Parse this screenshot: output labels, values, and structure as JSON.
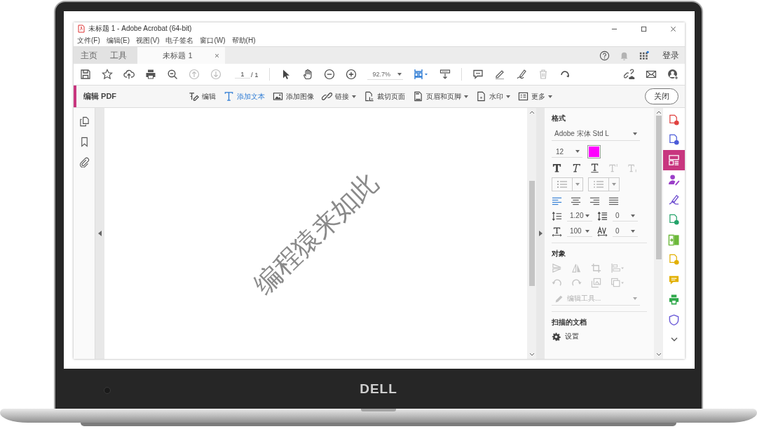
{
  "window": {
    "title": "未标题 1 - Adobe Acrobat (64-bit)"
  },
  "menu": [
    "文件(F)",
    "编辑(E)",
    "视图(V)",
    "电子签名",
    "窗口(W)",
    "帮助(H)"
  ],
  "nav_tabs": [
    {
      "label": "主页",
      "selected": false
    },
    {
      "label": "工具",
      "selected": false
    }
  ],
  "doc_tabs": [
    {
      "label": "未标题 1",
      "selected": true
    }
  ],
  "account": {
    "sign_in": "登录"
  },
  "toolbar": {
    "page": "1",
    "page_total": "/ 1",
    "zoom": "92.7%"
  },
  "edit_bar": {
    "title": "编辑 PDF",
    "close": "关闭",
    "tools": [
      {
        "kind": "edit",
        "label": "编辑",
        "selected": false,
        "dropdown": false
      },
      {
        "kind": "text",
        "label": "添加文本",
        "selected": true,
        "dropdown": false
      },
      {
        "kind": "image",
        "label": "添加图像",
        "selected": false,
        "dropdown": false
      },
      {
        "kind": "link",
        "label": "链接",
        "selected": false,
        "dropdown": true
      },
      {
        "kind": "crop",
        "label": "裁切页面",
        "selected": false,
        "dropdown": false
      },
      {
        "kind": "header",
        "label": "页眉和页脚",
        "selected": false,
        "dropdown": true
      },
      {
        "kind": "watermark",
        "label": "水印",
        "selected": false,
        "dropdown": true
      },
      {
        "kind": "more",
        "label": "更多",
        "selected": false,
        "dropdown": true
      }
    ]
  },
  "document": {
    "text": "编程猿来如此"
  },
  "format_panel": {
    "heading": "格式",
    "font": "Adobe 宋体 Std L",
    "size": "12",
    "color": "#ff00ff",
    "text_styles": [
      {
        "kind": "bold",
        "disabled": false
      },
      {
        "kind": "italic",
        "disabled": false
      },
      {
        "kind": "underline",
        "disabled": false
      },
      {
        "kind": "superscript",
        "disabled": true
      },
      {
        "kind": "subscript",
        "disabled": true
      }
    ],
    "align": [
      {
        "kind": "left",
        "selected": true
      },
      {
        "kind": "center",
        "selected": false
      },
      {
        "kind": "right",
        "selected": false
      },
      {
        "kind": "justify",
        "selected": false
      }
    ],
    "line_spacing": "1.20",
    "paragraph_spacing": "0",
    "scale": "100",
    "tracking": "0"
  },
  "objects_panel": {
    "heading": "对象",
    "edit_tool": "编辑工具...",
    "disabled": true
  },
  "scan_panel": {
    "heading": "扫描的文档",
    "settings": "设置"
  },
  "tool_rail": [
    {
      "kind": "doc",
      "color": "#e0413f",
      "selected": false
    },
    {
      "kind": "doc",
      "color": "#4b5bd8",
      "selected": false
    },
    {
      "kind": "layout",
      "color": "#c8367f",
      "selected": true
    },
    {
      "kind": "person",
      "color": "#9b3fc8",
      "selected": false
    },
    {
      "kind": "pen",
      "color": "#7050d0",
      "selected": false
    },
    {
      "kind": "doc",
      "color": "#24a36a",
      "selected": false
    },
    {
      "kind": "columns",
      "color": "#6cb83a",
      "selected": false
    },
    {
      "kind": "doc",
      "color": "#e2b000",
      "selected": false
    },
    {
      "kind": "comment",
      "color": "#e2b000",
      "selected": false
    },
    {
      "kind": "printer",
      "color": "#2ea84a",
      "selected": false
    },
    {
      "kind": "shield",
      "color": "#6a5ad8",
      "selected": false
    }
  ],
  "laptop": {
    "logo": "DELL"
  }
}
